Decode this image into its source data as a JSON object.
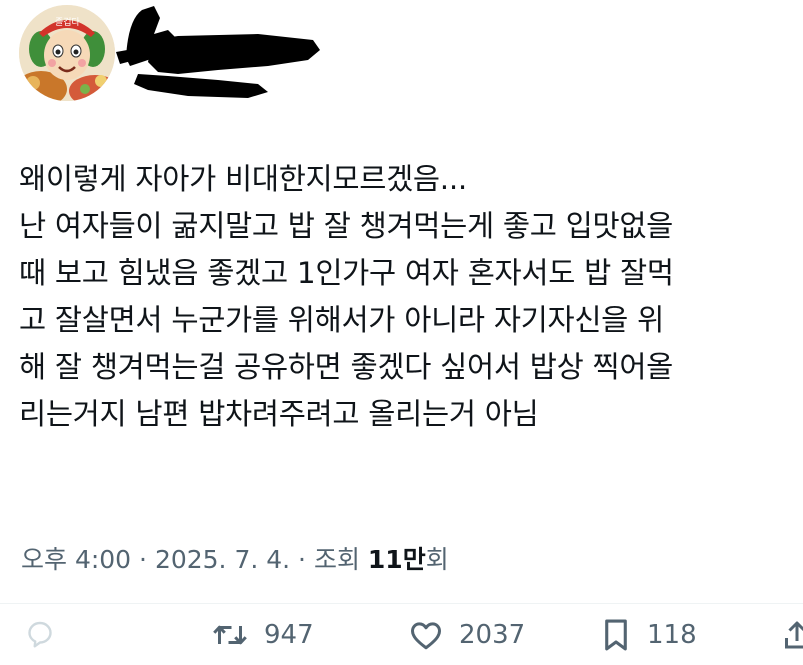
{
  "tweet": {
    "lines": [
      "왜이렇게 자아가 비대한지모르겠음...",
      "난 여자들이 굶지말고 밥 잘 챙겨먹는게 좋고 입맛없을",
      "때 보고 힘냈음 좋겠고 1인가구 여자 혼자서도 밥 잘먹",
      "고 잘살면서 누군가를 위해서가 아니라 자기자신을 위",
      "해 잘 챙겨먹는걸 공유하면 좋겠다 싶어서 밥상 찍어올",
      "리는거지 남편 밥차려주려고 올리는거 아님"
    ]
  },
  "avatar": {
    "badge_text": "즐겁다"
  },
  "meta": {
    "time": "오후 4:00",
    "sep1": " · ",
    "date": "2025. 7. 4.",
    "sep2": " · ",
    "views_label": "조회 ",
    "views_count": "11만",
    "views_suffix": "회"
  },
  "actions": {
    "retweets": "947",
    "likes": "2037",
    "bookmarks": "118"
  },
  "icons": {
    "reply": "reply-icon",
    "retweet": "retweet-icon",
    "like": "heart-icon",
    "bookmark": "bookmark-icon",
    "share": "share-icon"
  },
  "colors": {
    "text": "#0f1419",
    "secondary": "#536471",
    "divider": "#eff3f4"
  }
}
